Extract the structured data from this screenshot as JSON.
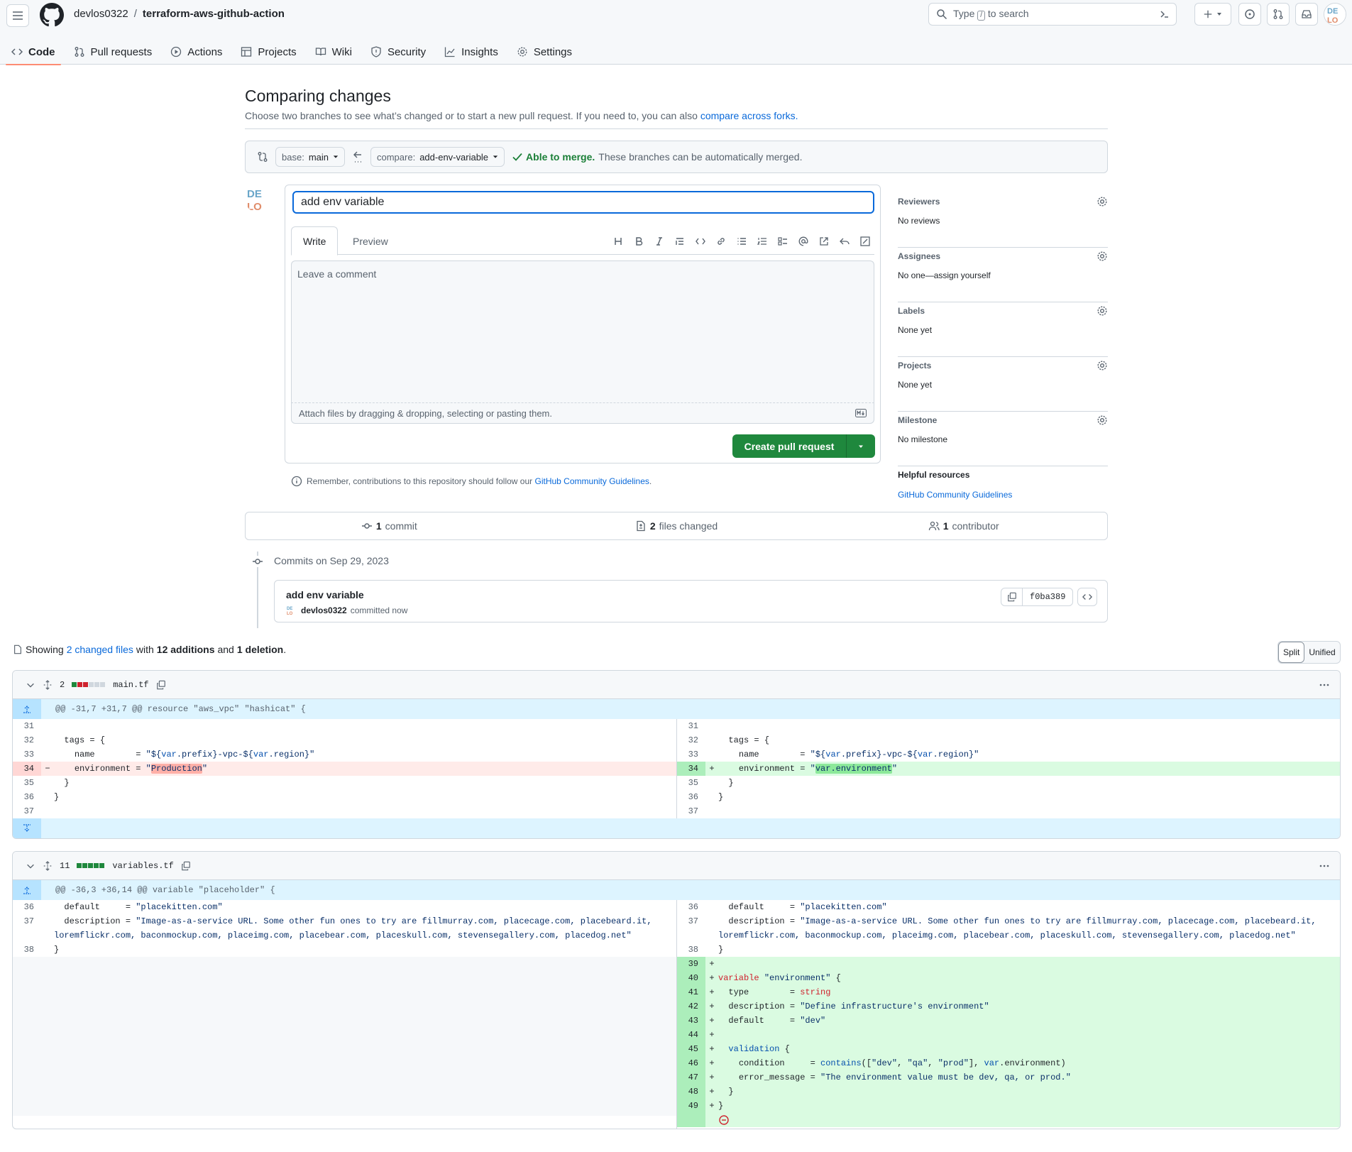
{
  "header": {
    "owner": "devlos0322",
    "separator": "/",
    "repo": "terraform-aws-github-action",
    "search_before": "Type",
    "search_key": "/",
    "search_after": "to search"
  },
  "nav": {
    "tabs": [
      {
        "label": "Code",
        "icon": "code-icon"
      },
      {
        "label": "Pull requests",
        "icon": "git-pull-request-icon"
      },
      {
        "label": "Actions",
        "icon": "play-icon"
      },
      {
        "label": "Projects",
        "icon": "table-icon"
      },
      {
        "label": "Wiki",
        "icon": "book-icon"
      },
      {
        "label": "Security",
        "icon": "shield-icon"
      },
      {
        "label": "Insights",
        "icon": "graph-icon"
      },
      {
        "label": "Settings",
        "icon": "gear-icon"
      }
    ]
  },
  "page": {
    "title": "Comparing changes",
    "subtitle": "Choose two branches to see what’s changed or to start a new pull request. If you need to, you can also",
    "subtitle_link": "compare across forks."
  },
  "range": {
    "base_prefix": "base:",
    "base": "main",
    "compare_prefix": "compare:",
    "compare": "add-env-variable",
    "merge_status": "Able to merge.",
    "merge_text": "These branches can be automatically merged."
  },
  "form": {
    "title_value": "add env variable",
    "tab_write": "Write",
    "tab_preview": "Preview",
    "comment_placeholder": "Leave a comment",
    "attach_text": "Attach files by dragging & dropping, selecting or pasting them.",
    "create_label": "Create pull request",
    "remember_text": "Remember, contributions to this repository should follow our",
    "remember_link": "GitHub Community Guidelines",
    "remember_end": "."
  },
  "sidebar": {
    "sections": [
      {
        "heading": "Reviewers",
        "value": "No reviews"
      },
      {
        "heading": "Assignees",
        "value": "No one—assign yourself"
      },
      {
        "heading": "Labels",
        "value": "None yet"
      },
      {
        "heading": "Projects",
        "value": "None yet"
      },
      {
        "heading": "Milestone",
        "value": "No milestone"
      }
    ],
    "helpful_heading": "Helpful resources",
    "helpful_link": "GitHub Community Guidelines"
  },
  "stats": {
    "commits_n": "1",
    "commits_label": "commit",
    "files_n": "2",
    "files_label": "files changed",
    "contrib_n": "1",
    "contrib_label": "contributor"
  },
  "commits": {
    "date_label": "Commits on Sep 29, 2023",
    "message": "add env variable",
    "author": "devlos0322",
    "time": "committed now",
    "sha": "f0ba389"
  },
  "summary": {
    "showing": "Showing",
    "changed_files": "2 changed files",
    "with": "with",
    "additions": "12 additions",
    "and": "and",
    "deletions": "1 deletion",
    "end": "."
  },
  "view_toggle": {
    "split": "Split",
    "unified": "Unified"
  },
  "files": [
    {
      "count": "2",
      "name": "main.tf",
      "hunk": "@@ -31,7 +31,7 @@ resource \"aws_vpc\" \"hashicat\" {"
    },
    {
      "count": "11",
      "name": "variables.tf",
      "hunk": "@@ -36,3 +36,14 @@ variable \"placeholder\" {"
    }
  ],
  "colors": {
    "accent": "#0969da",
    "success": "#1f883d",
    "add_bg": "#dafbe1",
    "del_bg": "#ffebe9"
  }
}
